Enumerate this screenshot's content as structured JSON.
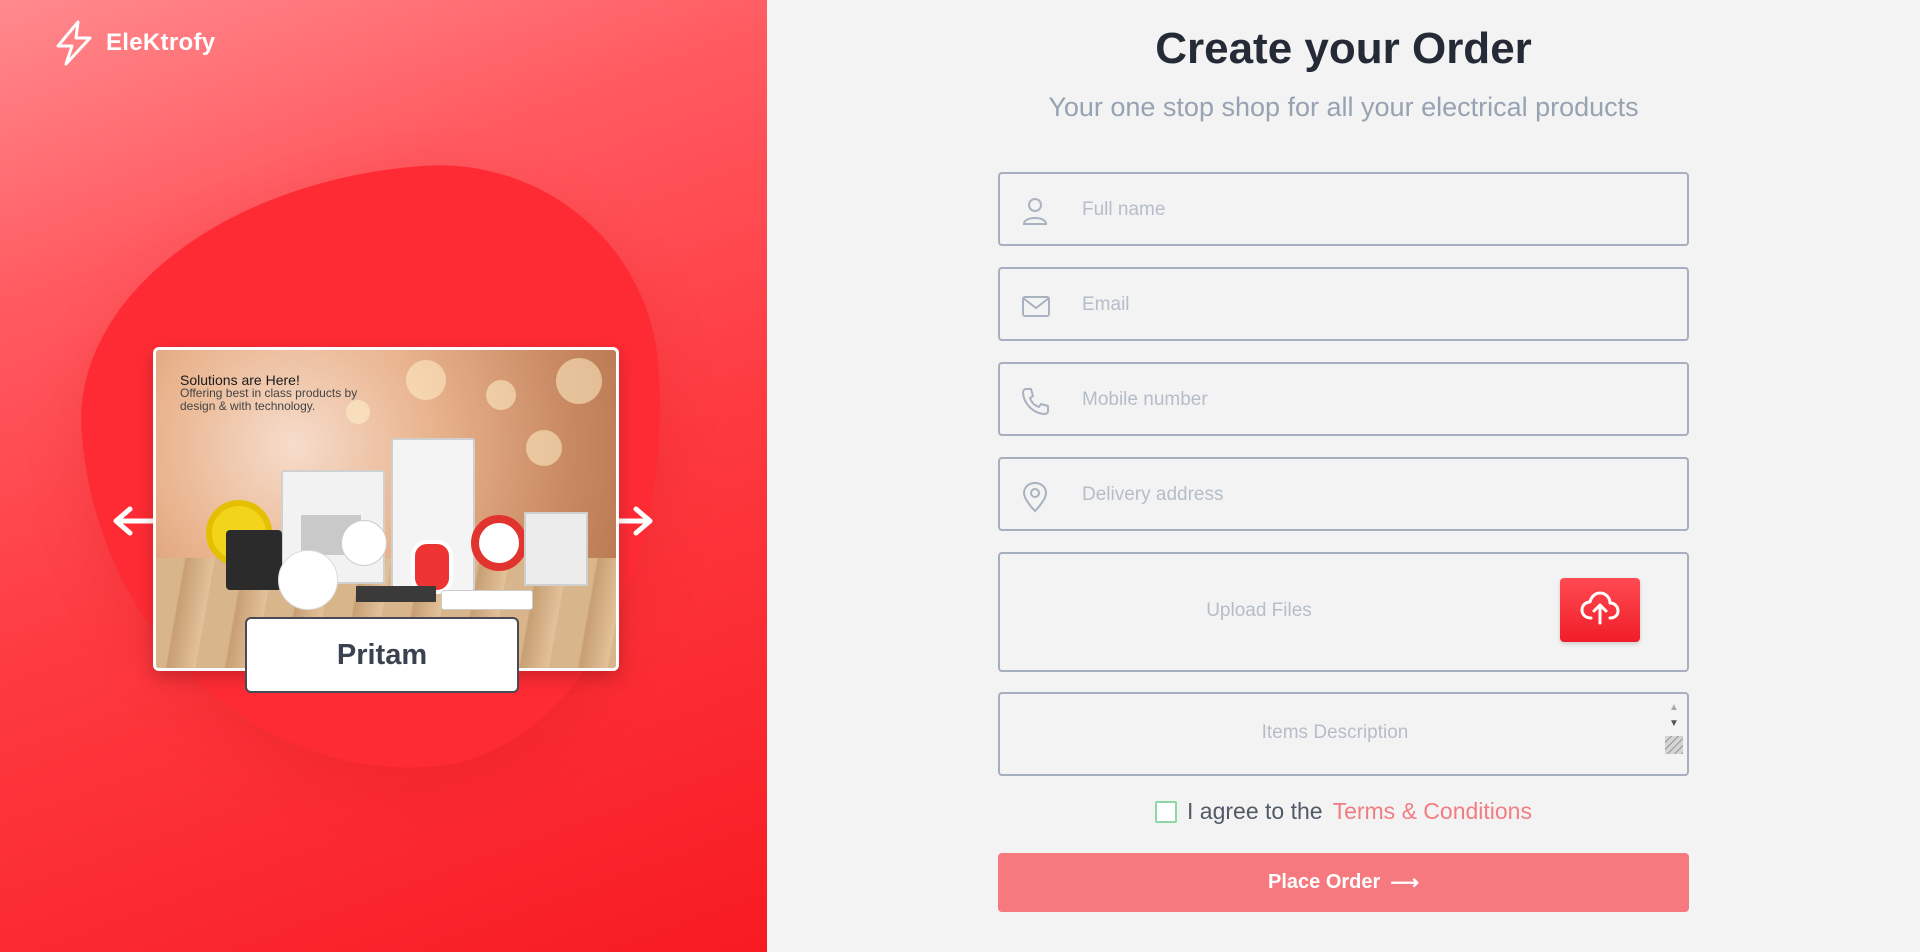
{
  "brand": {
    "name": "EleKtrofy",
    "icon": "lightning-bolt-icon"
  },
  "carousel": {
    "slide_heading": "Solutions are Here!",
    "slide_subtext": "Offering best in class products by design & with technology.",
    "caption": "Pritam",
    "prev_icon": "arrow-left-icon",
    "next_icon": "arrow-right-icon"
  },
  "header": {
    "title": "Create your Order",
    "subtitle": "Your one stop shop for all your electrical products"
  },
  "form": {
    "full_name": {
      "placeholder": "Full name",
      "icon": "user-icon"
    },
    "email": {
      "placeholder": "Email",
      "icon": "mail-icon"
    },
    "mobile": {
      "placeholder": "Mobile number",
      "icon": "phone-icon"
    },
    "address": {
      "placeholder": "Delivery address",
      "icon": "map-pin-icon"
    },
    "upload": {
      "label": "Upload Files",
      "icon": "cloud-upload-icon"
    },
    "description": {
      "placeholder": "Items Description"
    },
    "agree_text": "I agree to the",
    "terms_link": "Terms & Conditions",
    "submit_label": "Place Order",
    "submit_arrow": "⟶"
  },
  "colors": {
    "accent": "#f5797e",
    "brand_red": "#ff2b34",
    "title": "#252b36",
    "subtitle": "#97a2b3",
    "link": "#f17d82"
  }
}
